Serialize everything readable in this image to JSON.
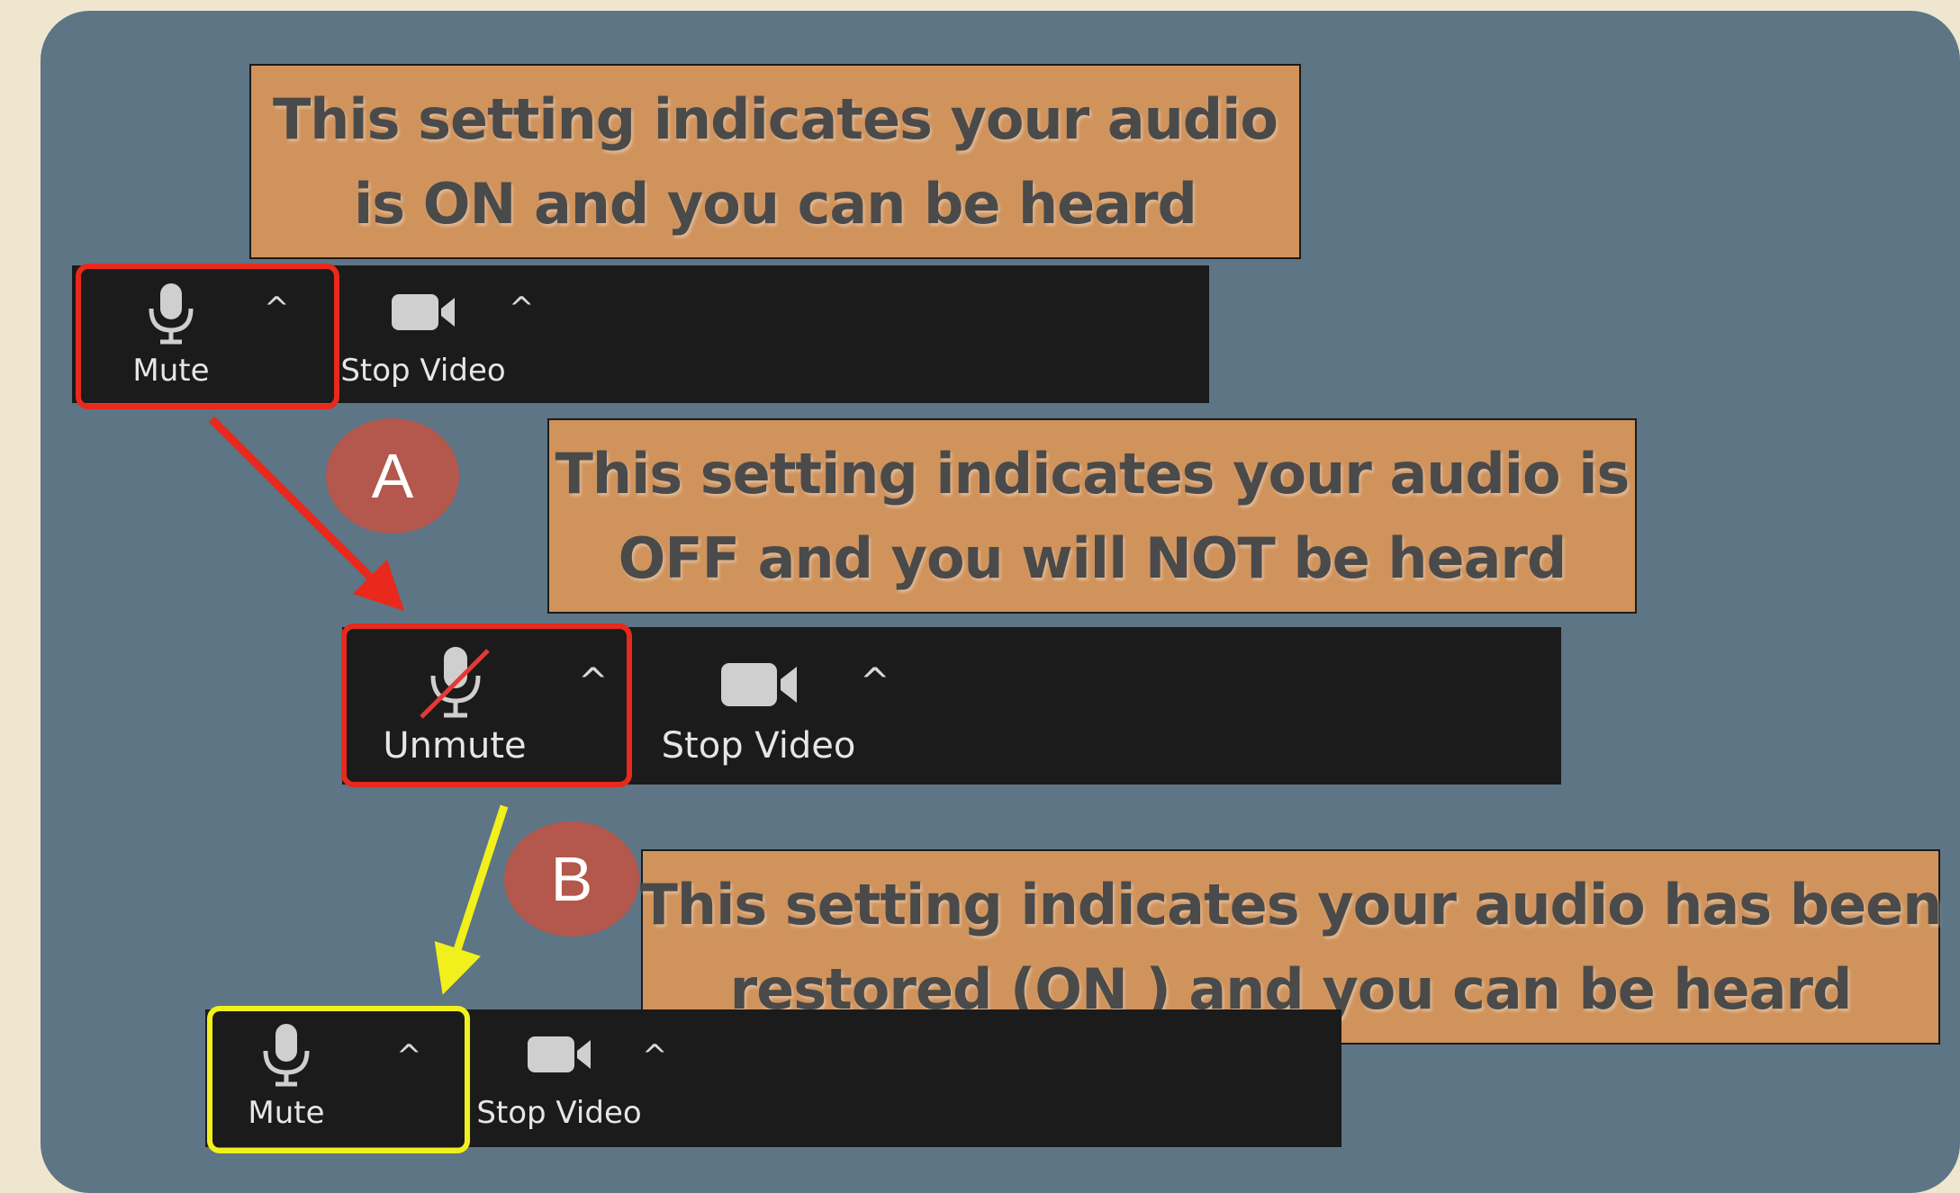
{
  "callouts": {
    "on": {
      "line1": "This setting indicates your audio",
      "line2": "is ON and you can be heard"
    },
    "off": {
      "line1": "This setting indicates your audio is",
      "line2": "OFF and you will NOT be heard"
    },
    "restored": {
      "line1": "This setting indicates your audio has been",
      "line2": "restored (ON ) and you can be heard"
    }
  },
  "toolbars": {
    "first": {
      "audio_label": "Mute",
      "video_label": "Stop Video",
      "audio_state": "unmuted"
    },
    "second": {
      "audio_label": "Unmute",
      "video_label": "Stop Video",
      "audio_state": "muted"
    },
    "third": {
      "audio_label": "Mute",
      "video_label": "Stop Video",
      "audio_state": "unmuted"
    }
  },
  "caret_glyph": "^",
  "badges": {
    "a": "A",
    "b": "B"
  },
  "colors": {
    "background_panel": "#5d7585",
    "callout_fill": "#d0935c",
    "toolbar": "#1b1b1b",
    "highlight_red": "#e8291c",
    "highlight_yellow": "#f2f01c",
    "badge": "#b4574c",
    "mute_slash": "#e53935"
  },
  "icons": [
    "microphone-icon",
    "microphone-muted-icon",
    "video-camera-icon",
    "caret-up-icon"
  ]
}
